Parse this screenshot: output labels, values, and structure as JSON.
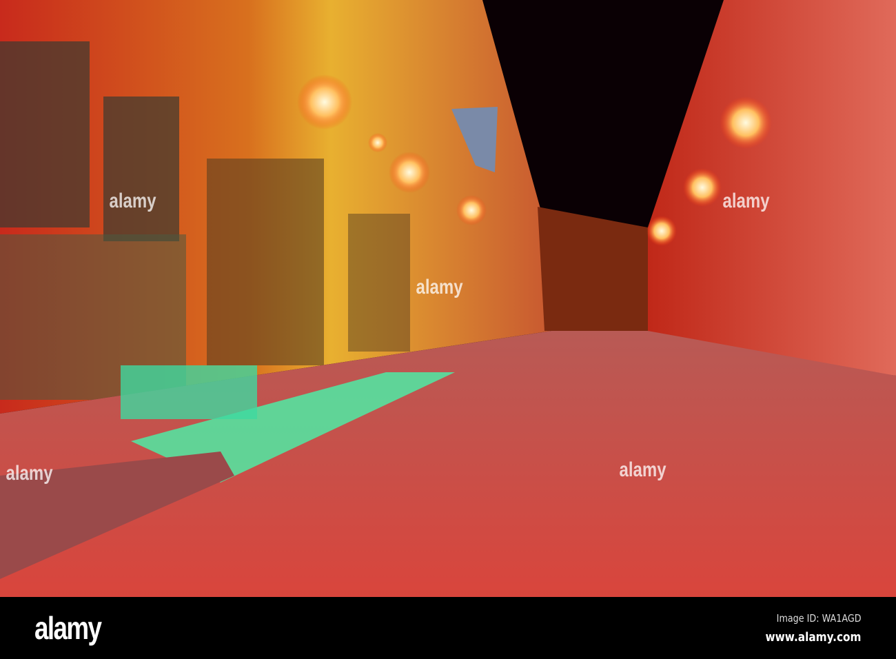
{
  "photo": {
    "subject": "night street with lanterns",
    "colors": {
      "sky": "#0a0004",
      "street": "#c9443a",
      "green_light": "#3fffb0",
      "lantern": "#fff0c8",
      "wall_red": "#e03020",
      "wall_yellow": "#e8a020"
    }
  },
  "watermark": {
    "text": "alamy"
  },
  "footer": {
    "logo": "alamy",
    "image_id": "Image ID: WA1AGD",
    "website": "www.alamy.com"
  }
}
